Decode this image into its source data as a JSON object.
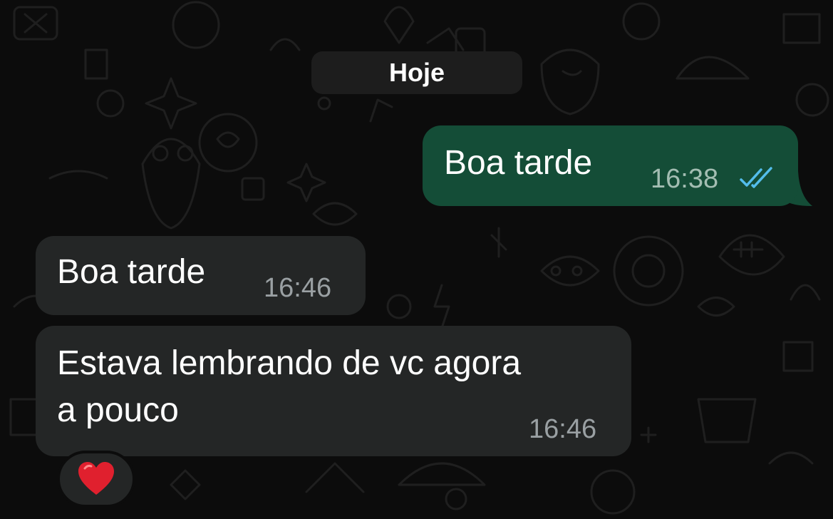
{
  "date_separator": "Hoje",
  "messages": [
    {
      "direction": "outgoing",
      "text": "Boa tarde",
      "time": "16:38",
      "status_icon": "double-check-icon",
      "status_color": "#53bdeb"
    },
    {
      "direction": "incoming",
      "text": "Boa tarde",
      "time": "16:46"
    },
    {
      "direction": "incoming",
      "text": "Estava lembrando de vc agora\na pouco",
      "time": "16:46",
      "reaction": "heart-icon"
    }
  ],
  "colors": {
    "background": "#0c0c0c",
    "outgoing_bubble": "#144d37",
    "incoming_bubble": "#242626",
    "date_pill": "#1d1d1d",
    "read_check": "#53bdeb",
    "heart": "#e0202e"
  }
}
